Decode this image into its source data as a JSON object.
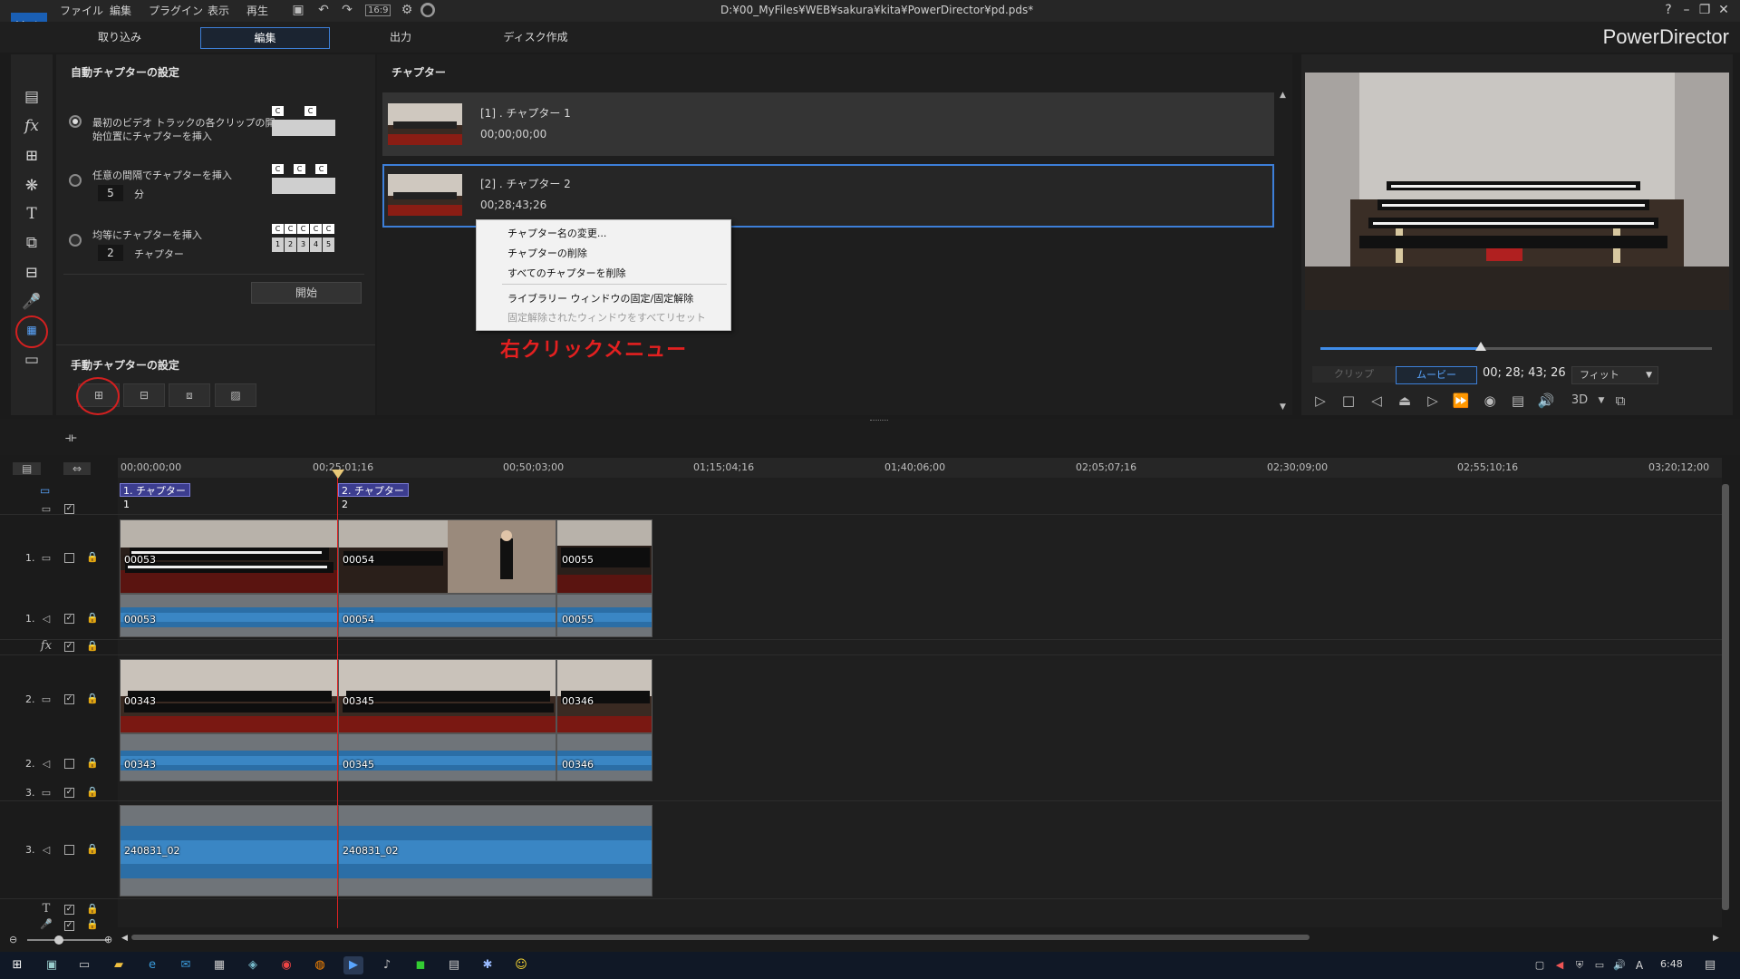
{
  "window": {
    "file_path": "D:¥00_MyFiles¥WEB¥sakura¥kita¥PowerDirector¥pd.pds*",
    "menu": [
      "ファイル",
      "編集",
      "プラグイン",
      "表示",
      "再生"
    ],
    "aspect_ratio": "16:9",
    "help": "?"
  },
  "mode_tabs": {
    "capture": "取り込み",
    "edit": "編集",
    "output": "出力",
    "disc": "ディスク作成",
    "active": "edit"
  },
  "brand": "PowerDirector",
  "auto_chapter": {
    "title": "自動チャプターの設定",
    "option1_line1": "最初のビデオ トラックの各クリップの開",
    "option1_line2": "始位置にチャプターを挿入",
    "option2_label": "任意の間隔でチャプターを挿入",
    "option2_value": "5",
    "option2_unit": "分",
    "option3_label": "均等にチャプターを挿入",
    "option3_value": "2",
    "option3_unit": "チャプター",
    "strip_c": "C",
    "strip_nums": [
      "1",
      "2",
      "3",
      "4",
      "5"
    ],
    "start_button": "開始"
  },
  "manual_chapter": {
    "title": "手動チャプターの設定"
  },
  "chapter_panel": {
    "title": "チャプター",
    "chapters": [
      {
        "name": "[1] . チャプター 1",
        "time": "00;00;00;00"
      },
      {
        "name": "[2] . チャプター 2",
        "time": "00;28;43;26"
      }
    ]
  },
  "context_menu": {
    "items": [
      "チャプター名の変更...",
      "チャプターの削除",
      "すべてのチャプターを削除"
    ],
    "items2": [
      "ライブラリー ウィンドウの固定/固定解除",
      "固定解除されたウィンドウをすべてリセット"
    ]
  },
  "annotation": "右クリックメニュー",
  "preview": {
    "clip_label": "クリップ",
    "movie_label": "ムービー",
    "timecode": "00; 28; 43; 26",
    "fit_label": "フィット",
    "threed_label": "3D",
    "playback_position": 0.41
  },
  "timeline": {
    "ruler_ticks": [
      "00;00;00;00",
      "00;25;01;16",
      "00;50;03;00",
      "01;15;04;16",
      "01;40;06;00",
      "02;05;07;16",
      "02;30;09;00",
      "02;55;10;16",
      "03;20;12;00"
    ],
    "chapter_markers": [
      "1. チャプター 1",
      "2. チャプター 2"
    ],
    "track_labels": {
      "t1": "1.",
      "t2": "2.",
      "t3": "3."
    },
    "track1_video": [
      "00053",
      "00054",
      "00055"
    ],
    "track1_audio": [
      "00053",
      "00054",
      "00055"
    ],
    "track2_video": [
      "00343",
      "00345",
      "00346"
    ],
    "track2_audio": [
      "00343",
      "00345",
      "00346"
    ],
    "track3_audio": [
      "240831_02",
      "240831_02"
    ],
    "check": "✓"
  },
  "taskbar": {
    "time": "6:48",
    "ime": "A"
  }
}
